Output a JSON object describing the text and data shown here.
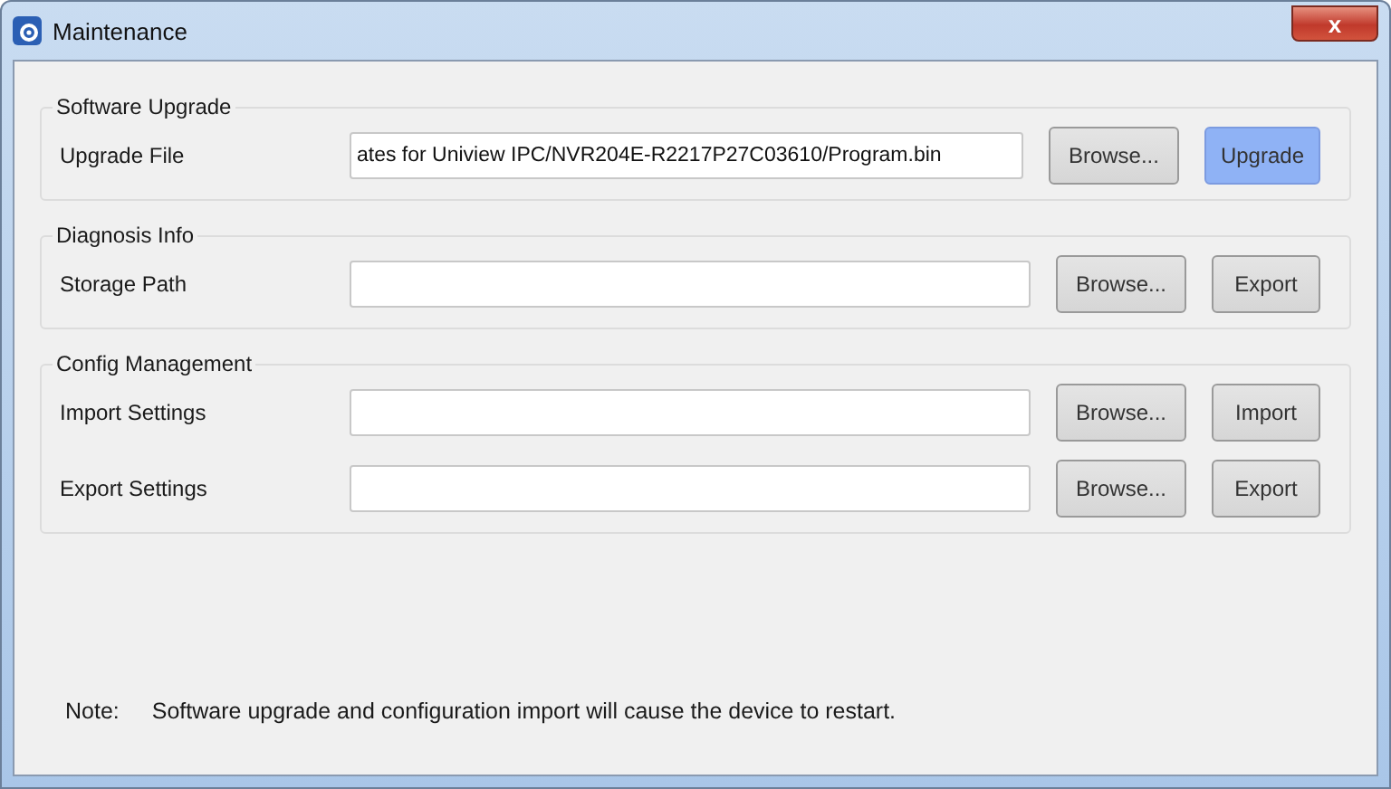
{
  "window": {
    "title": "Maintenance",
    "close": "x"
  },
  "sections": [
    {
      "title": "Software Upgrade",
      "rows": [
        {
          "label": "Upgrade File",
          "value": "ates for Uniview IPC/NVR204E-R2217P27C03610/Program.bin",
          "buttons": [
            {
              "label": "Browse...",
              "highlighted": false
            },
            {
              "label": "Upgrade",
              "highlighted": true
            }
          ]
        }
      ]
    },
    {
      "title": "Diagnosis Info",
      "rows": [
        {
          "label": "Storage Path",
          "value": "",
          "buttons": [
            {
              "label": "Browse...",
              "highlighted": false
            },
            {
              "label": "Export",
              "highlighted": false
            }
          ]
        }
      ]
    },
    {
      "title": "Config Management",
      "rows": [
        {
          "label": "Import Settings",
          "value": "",
          "buttons": [
            {
              "label": "Browse...",
              "highlighted": false
            },
            {
              "label": "Import",
              "highlighted": false
            }
          ]
        },
        {
          "label": "Export Settings",
          "value": "",
          "buttons": [
            {
              "label": "Browse...",
              "highlighted": false
            },
            {
              "label": "Export",
              "highlighted": false
            }
          ]
        }
      ]
    }
  ],
  "note": {
    "label": "Note:",
    "text": "Software upgrade and configuration import will cause the device to restart."
  }
}
